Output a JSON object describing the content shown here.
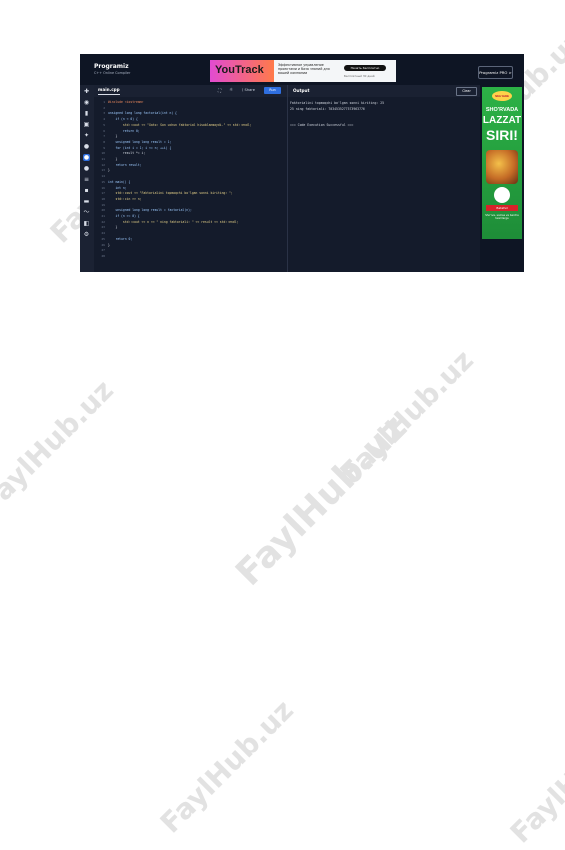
{
  "watermark": "FaylHub.uz",
  "header": {
    "logo_title": "Programiz",
    "logo_subtitle": "C++ Online Compiler",
    "pro_button": "Programiz PRO >"
  },
  "ad_banner": {
    "brand": "YouTrack",
    "text": "Эффективное управление проектами и базa знаний для вашей компании",
    "button": "Начать бесплатно",
    "sub": "Бесплатный 30 дней"
  },
  "editor": {
    "tab": "main.cpp",
    "share_label": "Share",
    "run_label": "Run",
    "line_numbers": [
      "1",
      "2",
      "3",
      "4",
      "5",
      "6",
      "7",
      "8",
      "9",
      "10",
      "11",
      "12",
      "13",
      "14",
      "15",
      "16",
      "17",
      "18",
      "19",
      "20",
      "21",
      "22",
      "23",
      "24",
      "25",
      "26",
      "27",
      "28"
    ],
    "lines": [
      "#include <iostream>",
      "",
      "unsigned long long factorial(int n) {",
      "    if (n < 0) {",
      "        std::cout << \"Xato: Son uchun faktorial hisoblanmaydi.\" << std::endl;",
      "        return 0;",
      "    }",
      "    unsigned long long result = 1;",
      "    for (int i = 1; i <= n; ++i) {",
      "        result *= i;",
      "    }",
      "    return result;",
      "}",
      "",
      "int main() {",
      "    int n;",
      "    std::cout << \"Faktorialini topmoqchi bo'lgan sonni kiriting: \";",
      "    std::cin >> n;",
      "",
      "    unsigned long long result = factorial(n);",
      "    if (n >= 0) {",
      "        std::cout << n << \" ning faktoriali: \" << result << std::endl;",
      "    }",
      "",
      "    return 0;",
      "}",
      "",
      ""
    ]
  },
  "output": {
    "title": "Output",
    "clear_label": "Clear",
    "lines": [
      "Faktorialini topmoqchi bo'lgan sonni kiriting: 25",
      "25 ning faktoriali: 7034535277573963776",
      "",
      "",
      "=== Code Execution Successful ==="
    ]
  },
  "right_ad": {
    "brand": "Shirinlik",
    "line1": "SHO'RVADA",
    "line2": "LAZZAT",
    "line3": "SIRI!",
    "button": "Batafsil",
    "small": "Sho'rva, somsa va barcha taomlarga"
  },
  "sidebar_icons": [
    "cplusplus-icon",
    "python-icon",
    "java-icon",
    "html-icon",
    "javascript-icon",
    "c-icon",
    "cpp-icon",
    "csharp-icon",
    "go-icon",
    "kotlin-icon",
    "r-icon",
    "swift-icon",
    "php-icon",
    "rust-icon"
  ]
}
